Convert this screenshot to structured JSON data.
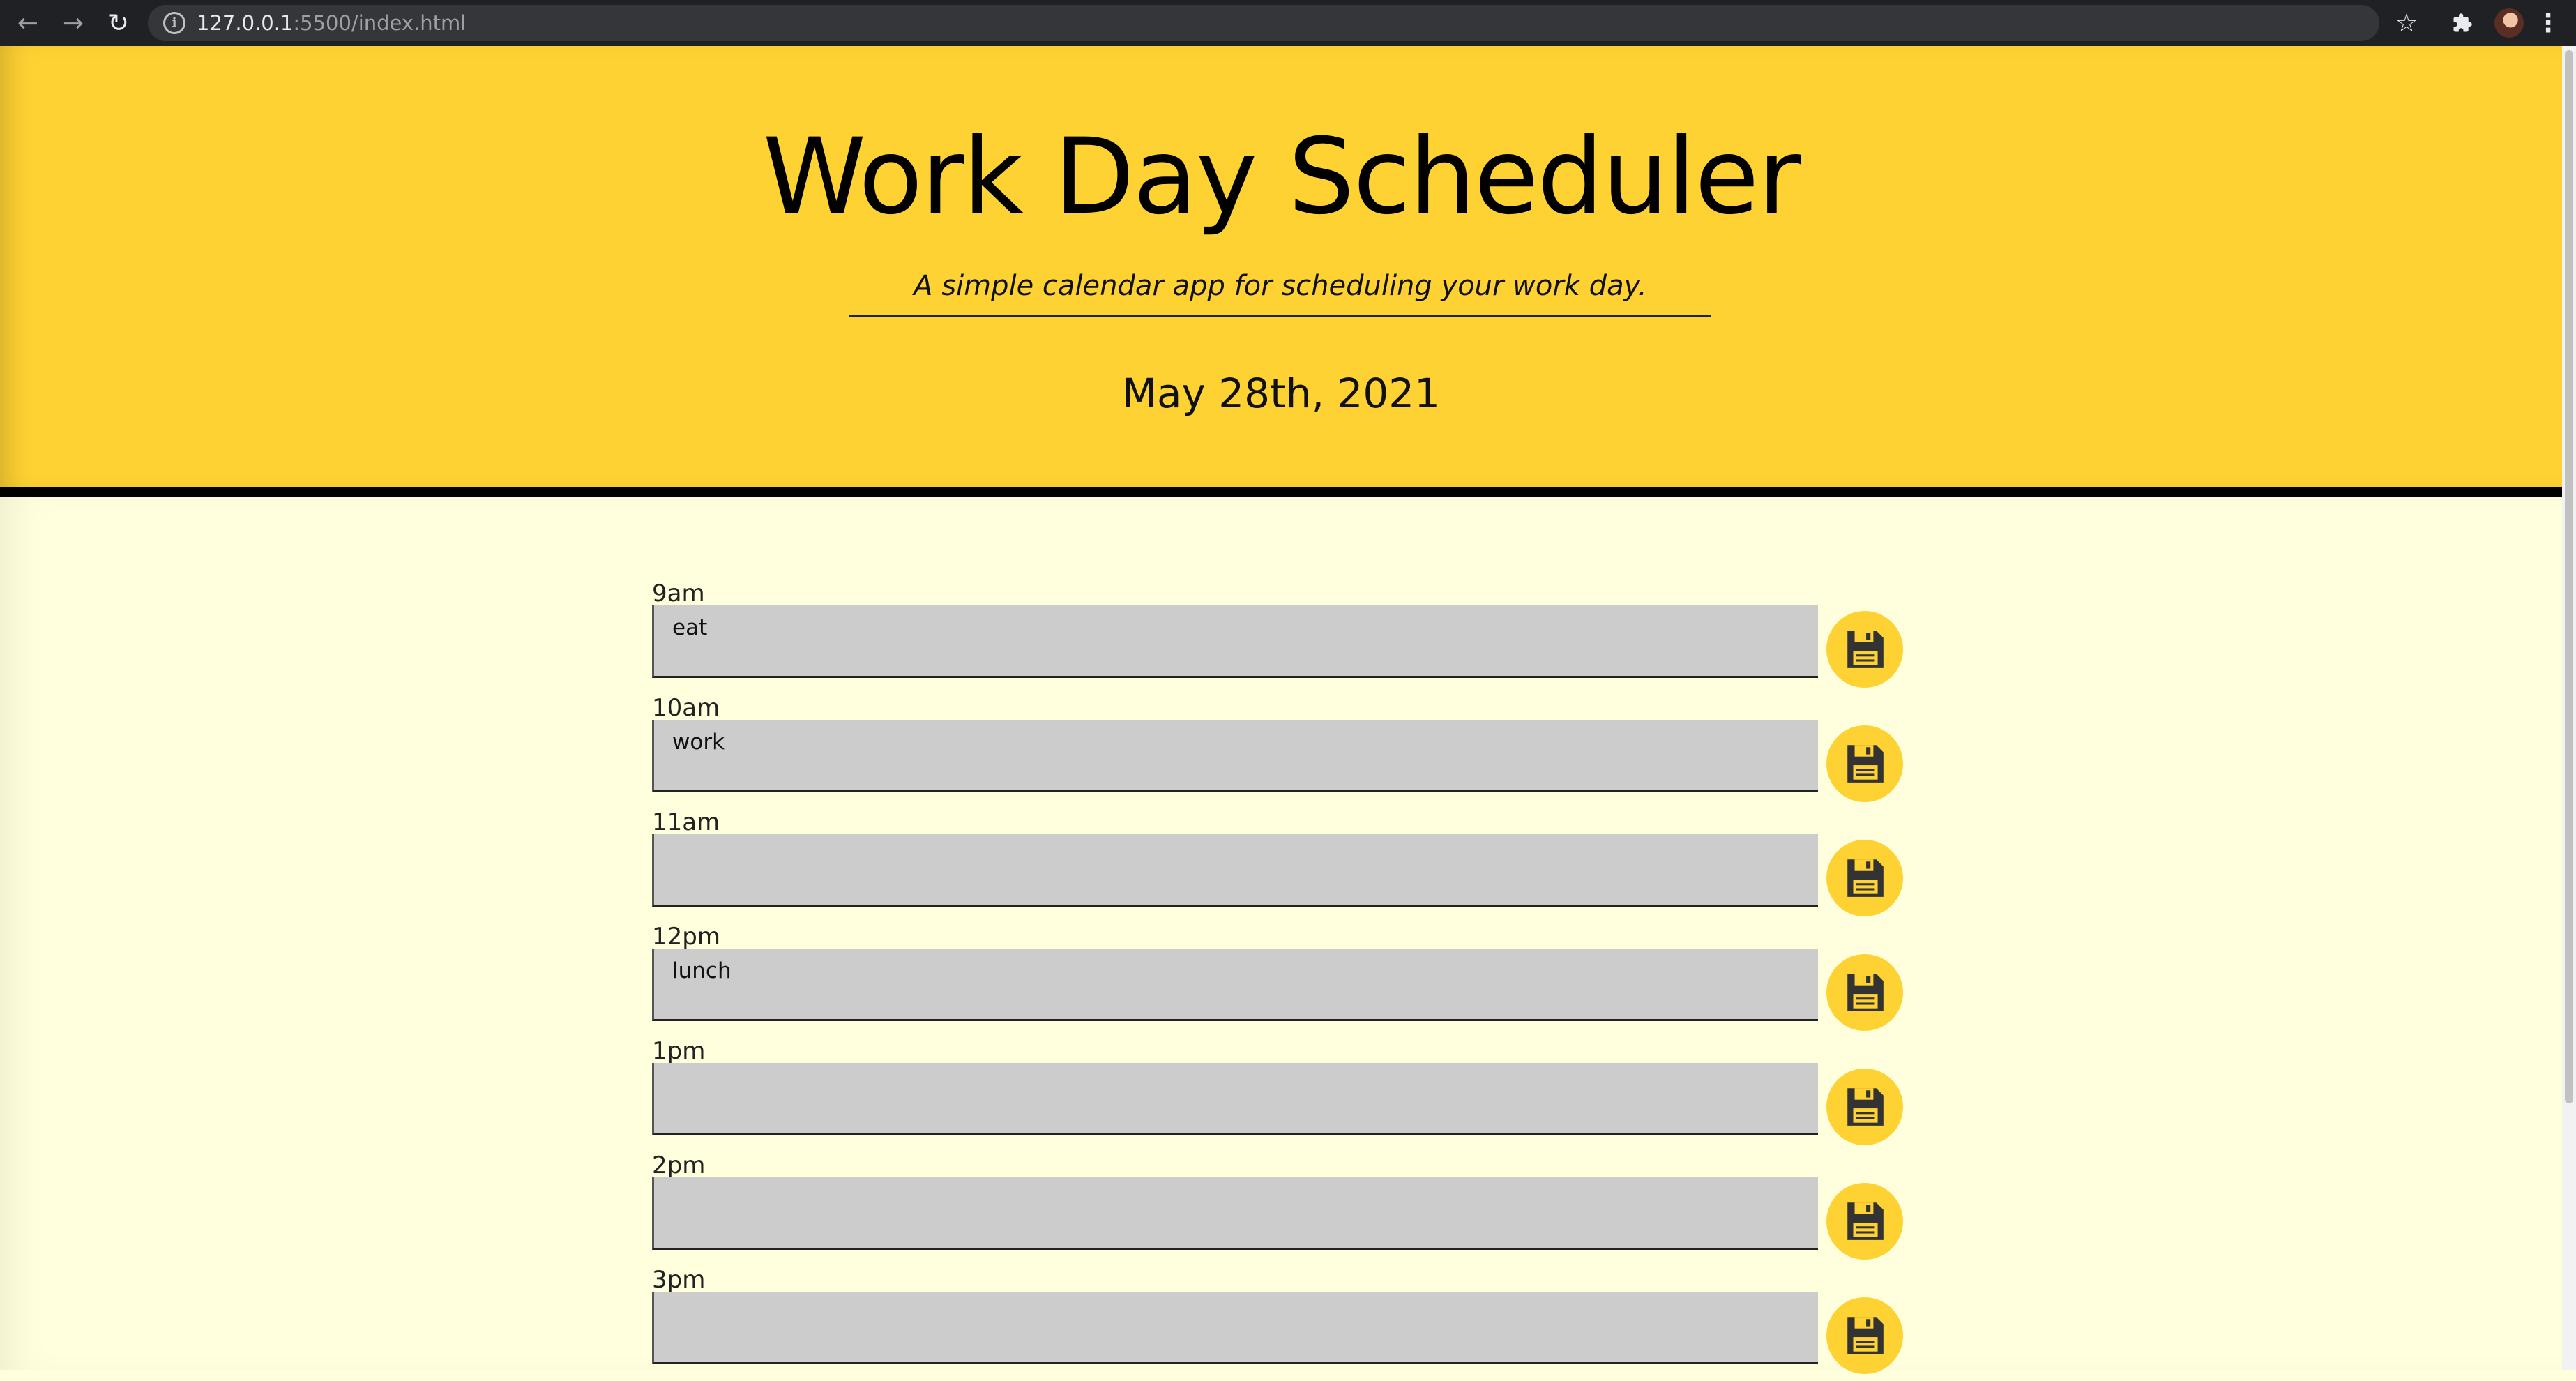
{
  "browser": {
    "url_host": "127.0.0.1",
    "url_rest": ":5500/index.html"
  },
  "header": {
    "title": "Work Day Scheduler",
    "subtitle": "A simple calendar app for scheduling your work day.",
    "current_day": "May 28th, 2021"
  },
  "schedule": [
    {
      "hour": "9am",
      "task": "eat"
    },
    {
      "hour": "10am",
      "task": "work"
    },
    {
      "hour": "11am",
      "task": ""
    },
    {
      "hour": "12pm",
      "task": "lunch"
    },
    {
      "hour": "1pm",
      "task": ""
    },
    {
      "hour": "2pm",
      "task": ""
    },
    {
      "hour": "3pm",
      "task": ""
    }
  ],
  "colors": {
    "accent": "#ffd233",
    "page_background": "#ffffdd",
    "input_background": "#cccccc"
  },
  "icons": {
    "save": "floppy-disk-icon"
  }
}
